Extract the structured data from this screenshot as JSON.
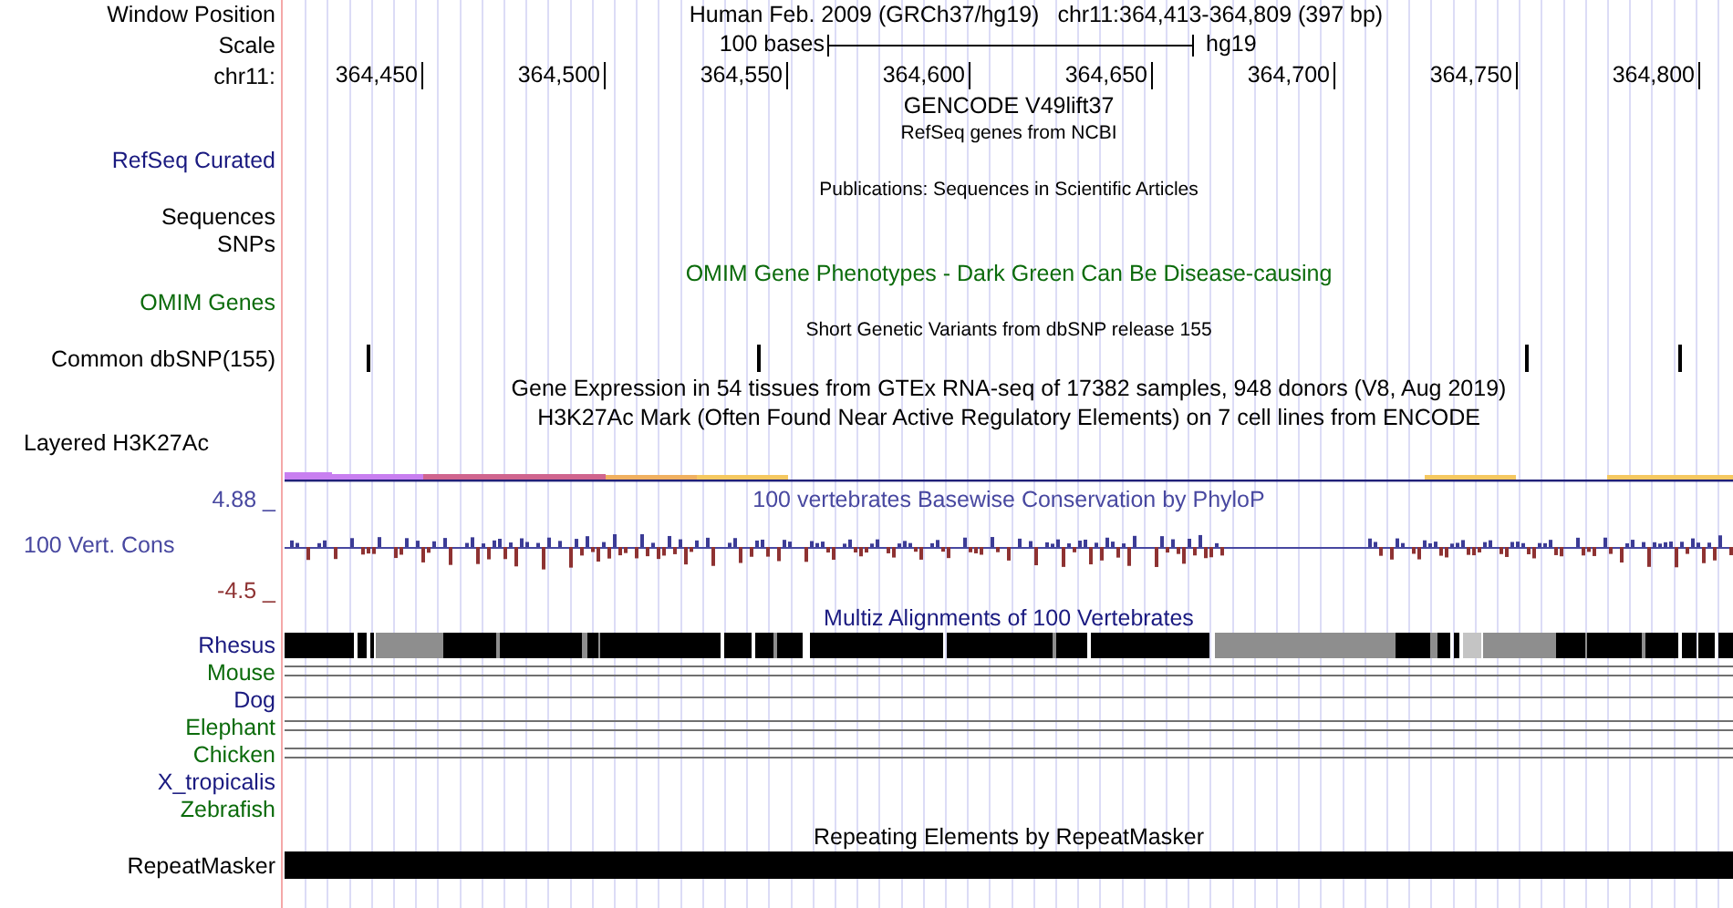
{
  "header": {
    "window_position_label": "Window Position",
    "assembly": "Human Feb. 2009 (GRCh37/hg19)",
    "position": "chr11:364,413-364,809 (397 bp)",
    "scale_label": "Scale",
    "scale_text": "100 bases",
    "scale_assembly": "hg19",
    "chrom_label": "chr11:",
    "ruler_ticks": [
      "364,450",
      "364,500",
      "364,550",
      "364,600",
      "364,650",
      "364,700",
      "364,750",
      "364,800"
    ]
  },
  "tracks": {
    "gencode_title": "GENCODE V49lift37",
    "refseq": {
      "title": "RefSeq genes from NCBI",
      "label": "RefSeq Curated"
    },
    "publications": {
      "title": "Publications: Sequences in Scientific Articles",
      "labels": [
        "Sequences",
        "SNPs"
      ]
    },
    "omim": {
      "title": "OMIM Gene Phenotypes - Dark Green Can Be Disease-causing",
      "label": "OMIM Genes"
    },
    "dbsnp": {
      "title": "Short Genetic Variants from dbSNP release 155",
      "label": "Common dbSNP(155)"
    },
    "gtex": {
      "title": "Gene Expression in 54 tissues from GTEx RNA-seq of 17382 samples, 948 donors (V8, Aug 2019)"
    },
    "h3k27ac": {
      "title": "H3K27Ac Mark (Often Found Near Active Regulatory Elements) on 7 cell lines from ENCODE",
      "label": "Layered H3K27Ac"
    },
    "conservation": {
      "title": "100 vertebrates Basewise Conservation by PhyloP",
      "label": "100 Vert. Cons",
      "max": "4.88 _",
      "min": "-4.5 _"
    },
    "multiz": {
      "title": "Multiz Alignments of 100 Vertebrates",
      "species": [
        {
          "name": "Rhesus",
          "color": "#1a1a80"
        },
        {
          "name": "Mouse",
          "color": "#0b6b0b"
        },
        {
          "name": "Dog",
          "color": "#1a1a80"
        },
        {
          "name": "Elephant",
          "color": "#0b6b0b"
        },
        {
          "name": "Chicken",
          "color": "#0b6b0b"
        },
        {
          "name": "X_tropicalis",
          "color": "#1a1a80"
        },
        {
          "name": "Zebrafish",
          "color": "#0b6b0b"
        }
      ]
    },
    "repeatmasker": {
      "title": "Repeating Elements by RepeatMasker",
      "label": "RepeatMasker"
    }
  }
}
